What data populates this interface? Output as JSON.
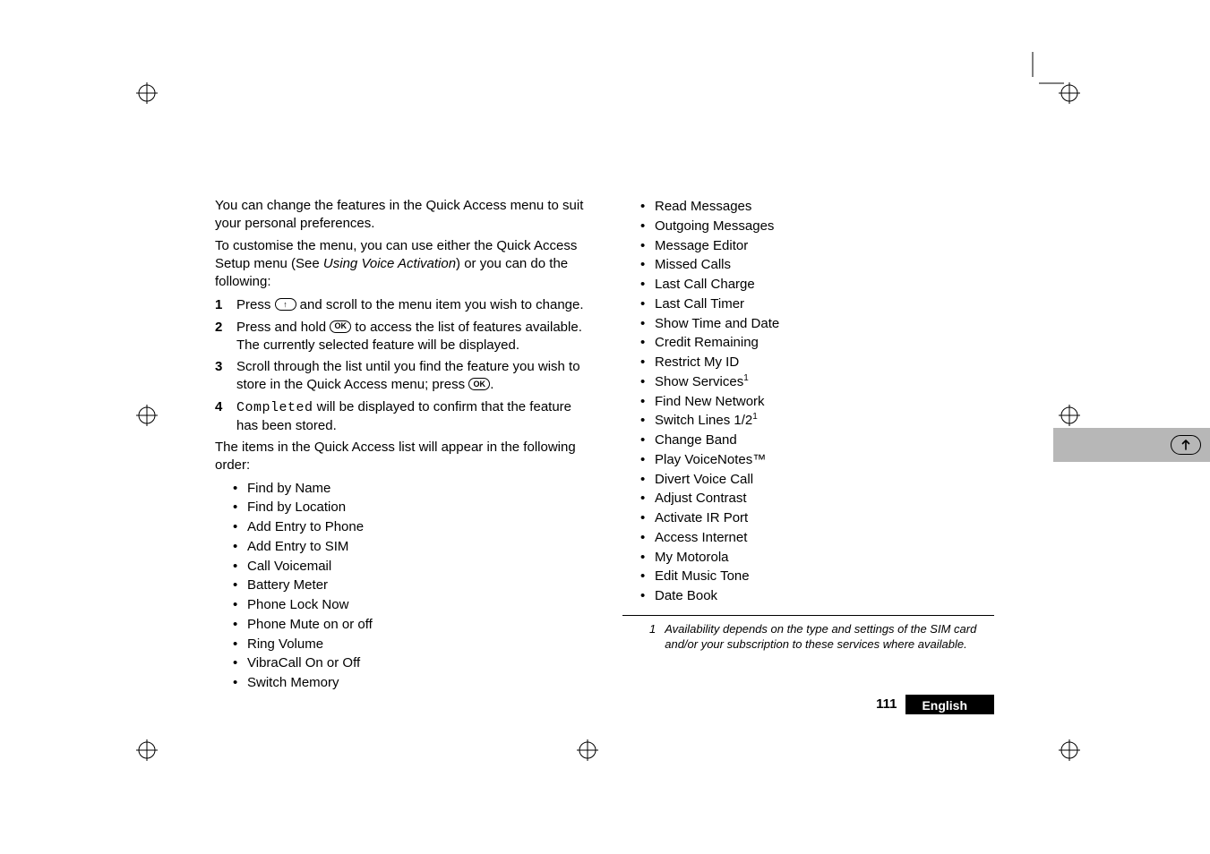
{
  "left": {
    "intro1_a": "You can change the features in the Quick Access menu to suit your personal preferences.",
    "intro2_a": "To customise the menu, you can use either the Quick Access Setup menu (See ",
    "intro2_i": "Using Voice Activation",
    "intro2_b": ") or you can do the following:",
    "steps": [
      {
        "n": "1",
        "pre": "Press ",
        "key": "↑",
        "post": " and scroll to the menu item you wish to change."
      },
      {
        "n": "2",
        "pre": "Press and hold ",
        "key": "OK",
        "post": " to access the list of features available. The currently selected feature will be displayed."
      },
      {
        "n": "3",
        "pre": "Scroll through the list until you find the feature you wish to store in the Quick Access menu; press ",
        "key": "OK",
        "post": "."
      },
      {
        "n": "4",
        "mono": "Completed",
        "plain": " will be displayed to confirm that the feature has been stored."
      }
    ],
    "list_intro": "The items in the Quick Access list will appear in the following order:",
    "bullets": [
      "Find by Name",
      "Find by Location",
      "Add Entry to Phone",
      "Add Entry to SIM",
      "Call Voicemail",
      "Battery Meter",
      "Phone Lock Now",
      "Phone Mute on or off",
      "Ring Volume",
      "VibraCall On or Off",
      "Switch Memory"
    ]
  },
  "right": {
    "bullets": [
      {
        "t": "Read Messages"
      },
      {
        "t": "Outgoing Messages"
      },
      {
        "t": "Message Editor"
      },
      {
        "t": "Missed Calls"
      },
      {
        "t": "Last Call Charge"
      },
      {
        "t": "Last Call Timer"
      },
      {
        "t": "Show Time and Date"
      },
      {
        "t": "Credit Remaining"
      },
      {
        "t": "Restrict My ID"
      },
      {
        "t": "Show Services",
        "sup": "1"
      },
      {
        "t": "Find New Network"
      },
      {
        "t": "Switch Lines 1/2",
        "sup": "1"
      },
      {
        "t": "Change Band"
      },
      {
        "t": "Play VoiceNotes™"
      },
      {
        "t": "Divert Voice Call"
      },
      {
        "t": "Adjust Contrast"
      },
      {
        "t": "Activate IR Port"
      },
      {
        "t": "Access Internet"
      },
      {
        "t": "My Motorola"
      },
      {
        "t": "Edit Music Tone"
      },
      {
        "t": "Date Book"
      }
    ],
    "footnote_num": "1",
    "footnote": "Availability depends on the type and settings of the SIM card and/or your subscription to these services where available."
  },
  "footer": {
    "page": "111",
    "lang": "English"
  }
}
